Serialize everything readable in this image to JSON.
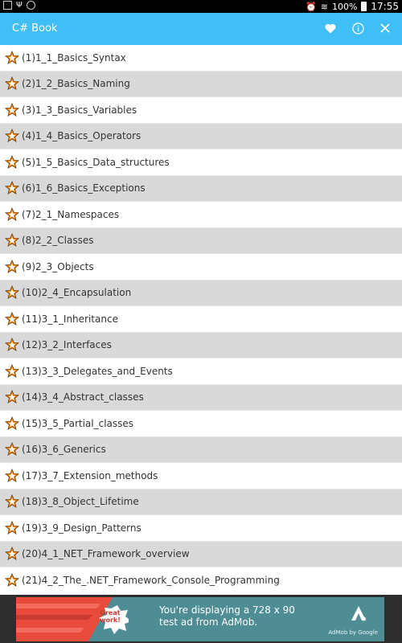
{
  "status_bar": {
    "battery": "100%",
    "time": "17:55"
  },
  "app_bar": {
    "title": "C# Book",
    "actions": [
      "heart-icon",
      "info-icon",
      "close-icon"
    ],
    "color": "#3fbff6"
  },
  "list": {
    "items": [
      "(1)1_1_Basics_Syntax",
      "(2)1_2_Basics_Naming",
      "(3)1_3_Basics_Variables",
      "(4)1_4_Basics_Operators",
      "(5)1_5_Basics_Data_structures",
      "(6)1_6_Basics_Exceptions",
      "(7)2_1_Namespaces",
      "(8)2_2_Classes",
      "(9)2_3_Objects",
      "(10)2_4_Encapsulation",
      "(11)3_1_Inheritance",
      "(12)3_2_Interfaces",
      "(13)3_3_Delegates_and_Events",
      "(14)3_4_Abstract_classes",
      "(15)3_5_Partial_classes",
      "(16)3_6_Generics",
      "(17)3_7_Extension_methods",
      "(18)3_8_Object_Lifetime",
      "(19)3_9_Design_Patterns",
      "(20)4_1_NET_Framework_overview",
      "(21)4_2_The_.NET_Framework_Console_Programming"
    ],
    "alt_row_color": "#d9d9d9",
    "star_color": "#f57c00"
  },
  "ad": {
    "badge": "Great work!",
    "line1": "You're displaying a 728 x 90",
    "line2": "test ad from AdMob.",
    "brand": "AdMob by Google"
  }
}
